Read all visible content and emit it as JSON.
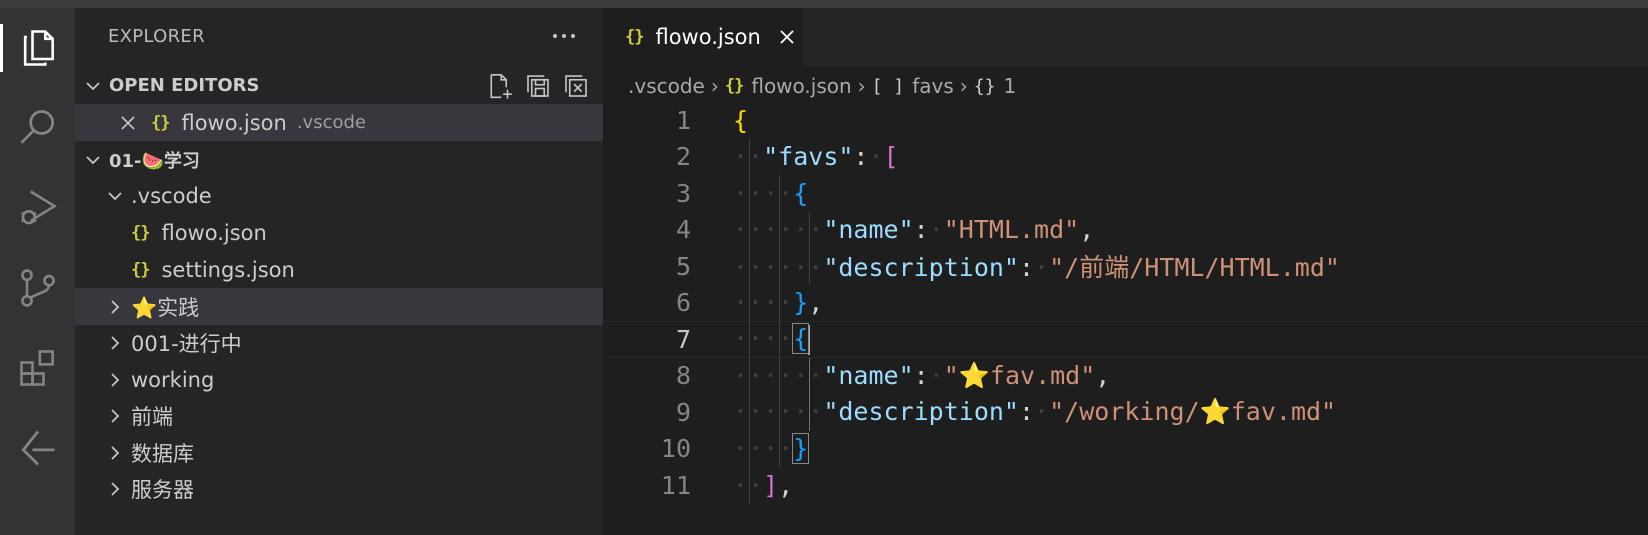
{
  "explorer": {
    "title": "EXPLORER",
    "more_label": "···",
    "open_editors": {
      "label": "OPEN EDITORS",
      "items": [
        {
          "icon": "{}",
          "name": "flowo.json",
          "path": ".vscode"
        }
      ]
    },
    "folder": {
      "label": "01-🍉学习",
      "tree": [
        {
          "label": ".vscode",
          "expanded": true
        },
        {
          "icon": "{}",
          "label": "flowo.json"
        },
        {
          "icon": "{}",
          "label": "settings.json"
        },
        {
          "label": "⭐实践"
        },
        {
          "label": "001-进行中"
        },
        {
          "label": "working"
        },
        {
          "label": "前端"
        },
        {
          "label": "数据库"
        },
        {
          "label": "服务器"
        }
      ]
    }
  },
  "editor": {
    "tab": {
      "icon": "{}",
      "label": "flowo.json"
    },
    "breadcrumb": [
      {
        "label": ".vscode"
      },
      {
        "icon": "{}",
        "label": "flowo.json"
      },
      {
        "icon": "[ ]",
        "label": "favs"
      },
      {
        "icon": "{}",
        "label": "1"
      }
    ],
    "active_line": 7,
    "lines": [
      {
        "n": "1",
        "text": "{"
      },
      {
        "n": "2",
        "text": "  \"favs\": ["
      },
      {
        "n": "3",
        "text": "    {"
      },
      {
        "n": "4",
        "text": "      \"name\": \"HTML.md\","
      },
      {
        "n": "5",
        "text": "      \"description\": \"/前端/HTML/HTML.md\""
      },
      {
        "n": "6",
        "text": "    },"
      },
      {
        "n": "7",
        "text": "    {"
      },
      {
        "n": "8",
        "text": "      \"name\": \"⭐fav.md\","
      },
      {
        "n": "9",
        "text": "      \"description\": \"/working/⭐fav.md\""
      },
      {
        "n": "10",
        "text": "    }"
      },
      {
        "n": "11",
        "text": "  ],"
      }
    ],
    "tokens": {
      "favs_key": "\"favs\"",
      "name_key": "\"name\"",
      "desc_key": "\"description\"",
      "name1": "\"HTML.md\"",
      "desc1": "\"/前端/HTML/HTML.md\"",
      "name2": "\"⭐fav.md\"",
      "desc2": "\"/working/⭐fav.md\""
    }
  },
  "colors": {
    "activity_bar": "#333333",
    "sidebar": "#252526",
    "editor": "#1e1e1e",
    "json_icon": "#cbcb41",
    "key": "#9cdcfe",
    "string": "#ce9178",
    "bracket_level1": "#ffd700",
    "bracket_level2": "#da70d6",
    "bracket_level3": "#179fff"
  },
  "activity_icons": [
    "explorer-icon",
    "search-icon",
    "run-debug-icon",
    "source-control-icon",
    "extensions-icon",
    "remote-icon"
  ]
}
